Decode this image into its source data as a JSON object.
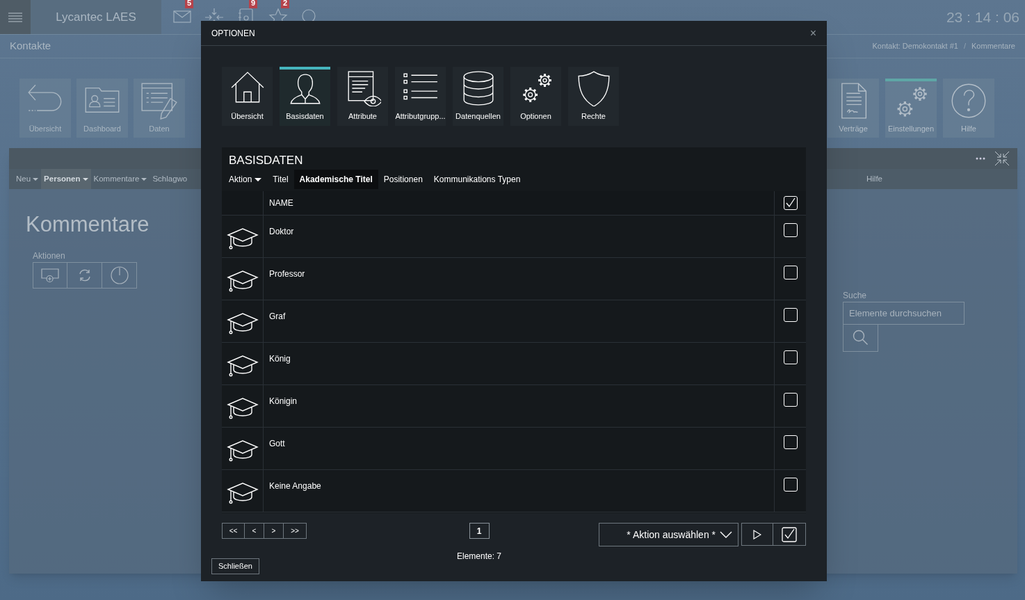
{
  "topbar": {
    "app_title": "Lycantec LAES",
    "badges": [
      "5",
      "9",
      "2"
    ],
    "clock": "23 : 14 : 06"
  },
  "page_title": "Kontakte",
  "breadcrumb": [
    "Kontakt: Demokontakt #1",
    "Kommentare"
  ],
  "breadcrumb_separator": "/",
  "modules_left": [
    {
      "label": "Übersicht",
      "selected": false
    },
    {
      "label": "Dashboard",
      "selected": false
    },
    {
      "label": "Daten",
      "selected": false
    }
  ],
  "modules_right": [
    {
      "label": "Verträge",
      "selected": false
    },
    {
      "label": "Einstellungen",
      "selected": true
    },
    {
      "label": "Hilfe",
      "selected": false
    }
  ],
  "panel": {
    "menu": [
      {
        "label": "Neu",
        "dropdown": true,
        "selected": false
      },
      {
        "label": "Personen",
        "dropdown": true,
        "selected": true
      },
      {
        "label": "Kommentare",
        "dropdown": true,
        "selected": false
      },
      {
        "label": "Schlagwo",
        "dropdown": false,
        "selected": false
      }
    ],
    "menu_right": [
      {
        "label": "Hilfe",
        "dropdown": false,
        "selected": false
      }
    ],
    "heading": "Kommentare",
    "actions_label": "Aktionen",
    "search_label": "Suche",
    "search_placeholder": "Elemente durchsuchen"
  },
  "dialog": {
    "title": "OPTIONEN",
    "close": "×",
    "tabs": [
      {
        "label": "Übersicht",
        "selected": false
      },
      {
        "label": "Basisdaten",
        "selected": true
      },
      {
        "label": "Attribute",
        "selected": false
      },
      {
        "label": "Attributgrupp...",
        "selected": false
      },
      {
        "label": "Datenquellen",
        "selected": false
      },
      {
        "label": "Optionen",
        "selected": false
      },
      {
        "label": "Rechte",
        "selected": false
      }
    ],
    "section_title": "BASISDATEN",
    "subnav": [
      {
        "label": "Aktion",
        "dropdown": true,
        "selected": false
      },
      {
        "label": "Titel",
        "dropdown": false,
        "selected": false
      },
      {
        "label": "Akademische Titel",
        "dropdown": false,
        "selected": true
      },
      {
        "label": "Positionen",
        "dropdown": false,
        "selected": false
      },
      {
        "label": "Kommunikations Typen",
        "dropdown": false,
        "selected": false
      }
    ],
    "table": {
      "column": "NAME",
      "all_checked": true,
      "rows": [
        {
          "name": "Doktor",
          "checked": false
        },
        {
          "name": "Professor",
          "checked": false
        },
        {
          "name": "Graf",
          "checked": false
        },
        {
          "name": "König",
          "checked": false
        },
        {
          "name": "Königin",
          "checked": false
        },
        {
          "name": "Gott",
          "checked": false
        },
        {
          "name": "Keine Angabe",
          "checked": false
        }
      ]
    },
    "pager": [
      "<<",
      "<",
      ">",
      ">>"
    ],
    "page": "1",
    "count": "Elemente: 7",
    "action_select": "* Aktion auswählen *",
    "close_button": "Schließen"
  }
}
